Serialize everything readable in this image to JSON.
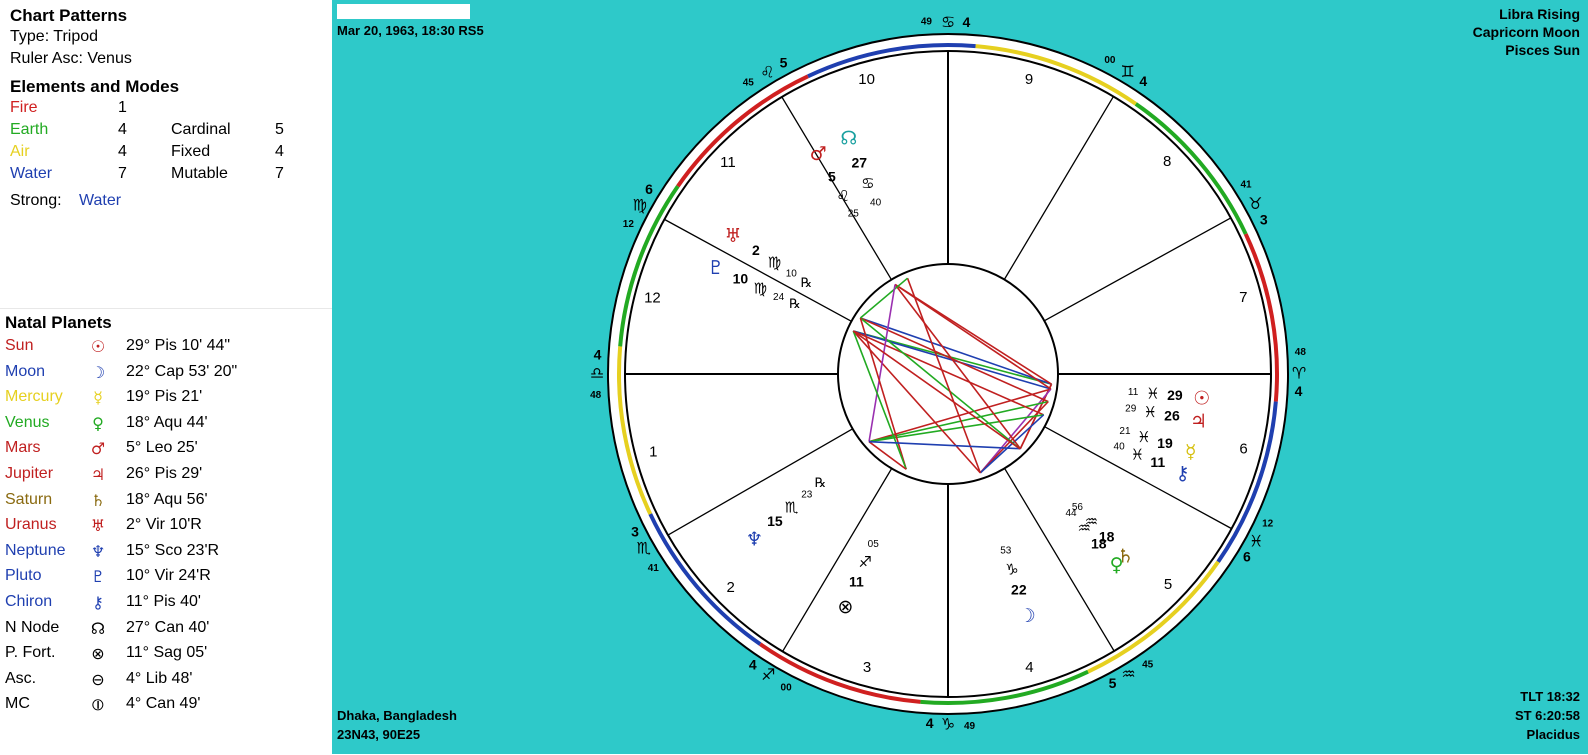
{
  "chart_patterns": {
    "title": "Chart Patterns",
    "type_label": "Type: Tripod",
    "ruler_label": "Ruler Asc: Venus"
  },
  "elements_modes": {
    "title": "Elements and Modes",
    "elements": [
      {
        "name": "Fire",
        "count": "1",
        "color": "#d02020"
      },
      {
        "name": "Earth",
        "count": "4",
        "color": "#22aa22"
      },
      {
        "name": "Air",
        "count": "4",
        "color": "#e6d020"
      },
      {
        "name": "Water",
        "count": "7",
        "color": "#1f3fb0"
      }
    ],
    "modes": [
      {
        "name": "Cardinal",
        "count": "5"
      },
      {
        "name": "Fixed",
        "count": "4"
      },
      {
        "name": "Mutable",
        "count": "7"
      }
    ],
    "strong_label": "Strong:",
    "strong_value": "Water",
    "strong_color": "#1f3fb0"
  },
  "natal_planets": {
    "title": "Natal Planets",
    "rows": [
      {
        "name": "Sun",
        "glyph": "☉",
        "position": "29° Pis 10' 44\"",
        "color": "#c02020"
      },
      {
        "name": "Moon",
        "glyph": "☽",
        "position": "22° Cap 53' 20\"",
        "color": "#1f3fb0"
      },
      {
        "name": "Mercury",
        "glyph": "☿",
        "position": "19° Pis 21'",
        "color": "#e6d020"
      },
      {
        "name": "Venus",
        "glyph": "♀",
        "position": "18° Aqu 44'",
        "color": "#22aa22"
      },
      {
        "name": "Mars",
        "glyph": "♂",
        "position": "5° Leo 25'",
        "color": "#c02020"
      },
      {
        "name": "Jupiter",
        "glyph": "♃",
        "position": "26° Pis 29'",
        "color": "#c02020"
      },
      {
        "name": "Saturn",
        "glyph": "♄",
        "position": "18° Aqu 56'",
        "color": "#8a6a10"
      },
      {
        "name": "Uranus",
        "glyph": "♅",
        "position": "2° Vir 10'R",
        "color": "#c02020"
      },
      {
        "name": "Neptune",
        "glyph": "♆",
        "position": "15° Sco 23'R",
        "color": "#1f3fb0"
      },
      {
        "name": "Pluto",
        "glyph": "♇",
        "position": "10° Vir 24'R",
        "color": "#1f3fb0"
      },
      {
        "name": "Chiron",
        "glyph": "⚷",
        "position": "11° Pis 40'",
        "color": "#1f3fb0"
      },
      {
        "name": "N Node",
        "glyph": "☊",
        "position": "27° Can 40'",
        "color": "#000000"
      },
      {
        "name": "P. Fort.",
        "glyph": "⊗",
        "position": "11° Sag 05'",
        "color": "#000000"
      },
      {
        "name": "Asc.",
        "glyph": "⊖",
        "position": "4° Lib 48'",
        "color": "#000000"
      },
      {
        "name": "MC",
        "glyph": "⦶",
        "position": "4° Can 49'",
        "color": "#000000"
      }
    ]
  },
  "header": {
    "name_field_value": "",
    "date_label": "Mar 20, 1963, 18:30  RS5",
    "rising": "Libra Rising",
    "moon_sign": "Capricorn Moon",
    "sun_sign": "Pisces Sun"
  },
  "footer": {
    "place": "Dhaka, Bangladesh",
    "coords": "23N43, 90E25",
    "tlt": "TLT 18:32",
    "st": "ST 6:20:58",
    "house_system": "Placidus"
  },
  "wheel": {
    "ascendant_longitude": 184.8,
    "cusps": [
      {
        "house": "1",
        "longitude": 184.8,
        "degree": "4",
        "sign_glyph": "♎",
        "minutes": "48"
      },
      {
        "house": "2",
        "longitude": 214.7,
        "degree": "3",
        "sign_glyph": "♏",
        "minutes": "41"
      },
      {
        "house": "3",
        "longitude": 244.0,
        "degree": "4",
        "sign_glyph": "♐",
        "minutes": "00"
      },
      {
        "house": "4",
        "longitude": 274.8,
        "degree": "4",
        "sign_glyph": "♑",
        "minutes": "49"
      },
      {
        "house": "5",
        "longitude": 305.75,
        "degree": "5",
        "sign_glyph": "♒",
        "minutes": "45"
      },
      {
        "house": "6",
        "longitude": 336.2,
        "degree": "6",
        "sign_glyph": "♓",
        "minutes": "12"
      },
      {
        "house": "7",
        "longitude": 4.8,
        "degree": "4",
        "sign_glyph": "♈",
        "minutes": "48"
      },
      {
        "house": "8",
        "longitude": 33.7,
        "degree": "3",
        "sign_glyph": "♉",
        "minutes": "41"
      },
      {
        "house": "9",
        "longitude": 64.0,
        "degree": "4",
        "sign_glyph": "♊",
        "minutes": "00"
      },
      {
        "house": "10",
        "longitude": 94.8,
        "degree": "4",
        "sign_glyph": "♋",
        "minutes": "49"
      },
      {
        "house": "11",
        "longitude": 125.75,
        "degree": "5",
        "sign_glyph": "♌",
        "minutes": "45"
      },
      {
        "house": "12",
        "longitude": 156.2,
        "degree": "6",
        "sign_glyph": "♍",
        "minutes": "12"
      }
    ],
    "house_numbers": [
      "1",
      "2",
      "3",
      "4",
      "5",
      "6",
      "7",
      "8",
      "9",
      "10",
      "11",
      "12"
    ],
    "sign_colors": [
      "#d02020",
      "#22aa22",
      "#e6d020",
      "#1f3fb0",
      "#d02020",
      "#22aa22",
      "#e6d020",
      "#1f3fb0",
      "#d02020",
      "#22aa22",
      "#e6d020",
      "#1f3fb0"
    ],
    "planets": [
      {
        "glyph": "☉",
        "longitude": 359.2,
        "degree": "29",
        "sign_glyph": "♓",
        "minutes": "11",
        "retro": "",
        "color": "#c02020"
      },
      {
        "glyph": "♃",
        "longitude": 356.5,
        "degree": "26",
        "sign_glyph": "♓",
        "minutes": "29",
        "retro": "",
        "color": "#c02020"
      },
      {
        "glyph": "☿",
        "longitude": 349.4,
        "degree": "19",
        "sign_glyph": "♓",
        "minutes": "21",
        "retro": "",
        "color": "#d6c010"
      },
      {
        "glyph": "⚷",
        "longitude": 341.7,
        "degree": "11",
        "sign_glyph": "♓",
        "minutes": "40",
        "retro": "",
        "color": "#1f3fb0"
      },
      {
        "glyph": "♄",
        "longitude": 318.9,
        "degree": "18",
        "sign_glyph": "♒",
        "minutes": "56",
        "retro": "",
        "color": "#8a6a10"
      },
      {
        "glyph": "♀",
        "longitude": 318.7,
        "degree": "18",
        "sign_glyph": "♒",
        "minutes": "44",
        "retro": "",
        "color": "#22aa22"
      },
      {
        "glyph": "☽",
        "longitude": 292.9,
        "degree": "22",
        "sign_glyph": "♑",
        "minutes": "53",
        "retro": "",
        "color": "#1f3fb0"
      },
      {
        "glyph": "☊",
        "longitude": 117.7,
        "degree": "27",
        "sign_glyph": "♋",
        "minutes": "40",
        "retro": "",
        "color": "#1aa0a0"
      },
      {
        "glyph": "♂",
        "longitude": 125.4,
        "degree": "5",
        "sign_glyph": "♌",
        "minutes": "25",
        "retro": "",
        "color": "#c02020"
      },
      {
        "glyph": "♅",
        "longitude": 152.2,
        "degree": "2",
        "sign_glyph": "♍",
        "minutes": "10",
        "retro": "℞",
        "color": "#c02020"
      },
      {
        "glyph": "♇",
        "longitude": 160.4,
        "degree": "10",
        "sign_glyph": "♍",
        "minutes": "24",
        "retro": "℞",
        "color": "#1f3fb0"
      },
      {
        "glyph": "♆",
        "longitude": 225.4,
        "degree": "15",
        "sign_glyph": "♏",
        "minutes": "23",
        "retro": "℞",
        "color": "#1f3fb0"
      },
      {
        "glyph": "⊗",
        "longitude": 251.1,
        "degree": "11",
        "sign_glyph": "♐",
        "minutes": "05",
        "retro": "",
        "color": "#000000"
      }
    ],
    "aspects": [
      {
        "a": 0,
        "b": 4,
        "color": "#c02020"
      },
      {
        "a": 0,
        "b": 5,
        "color": "#c02020"
      },
      {
        "a": 0,
        "b": 10,
        "color": "#22aa22"
      },
      {
        "a": 0,
        "b": 9,
        "color": "#1f3fb0"
      },
      {
        "a": 0,
        "b": 8,
        "color": "#c02020"
      },
      {
        "a": 1,
        "b": 10,
        "color": "#1f3fb0"
      },
      {
        "a": 1,
        "b": 11,
        "color": "#c02020"
      },
      {
        "a": 1,
        "b": 6,
        "color": "#9a30b0"
      },
      {
        "a": 1,
        "b": 8,
        "color": "#c02020"
      },
      {
        "a": 2,
        "b": 9,
        "color": "#c02020"
      },
      {
        "a": 2,
        "b": 11,
        "color": "#22aa22"
      },
      {
        "a": 2,
        "b": 6,
        "color": "#c02020"
      },
      {
        "a": 3,
        "b": 10,
        "color": "#c02020"
      },
      {
        "a": 3,
        "b": 11,
        "color": "#22aa22"
      },
      {
        "a": 3,
        "b": 6,
        "color": "#1f3fb0"
      },
      {
        "a": 4,
        "b": 8,
        "color": "#c02020"
      },
      {
        "a": 5,
        "b": 9,
        "color": "#22aa22"
      },
      {
        "a": 6,
        "b": 10,
        "color": "#c02020"
      },
      {
        "a": 6,
        "b": 7,
        "color": "#c02020"
      },
      {
        "a": 7,
        "b": 9,
        "color": "#22aa22"
      },
      {
        "a": 8,
        "b": 11,
        "color": "#9a30b0"
      },
      {
        "a": 9,
        "b": 12,
        "color": "#c02020"
      },
      {
        "a": 10,
        "b": 12,
        "color": "#22aa22"
      },
      {
        "a": 11,
        "b": 12,
        "color": "#c02020"
      },
      {
        "a": 4,
        "b": 11,
        "color": "#1f3fb0"
      },
      {
        "a": 5,
        "b": 10,
        "color": "#c02020"
      }
    ]
  }
}
